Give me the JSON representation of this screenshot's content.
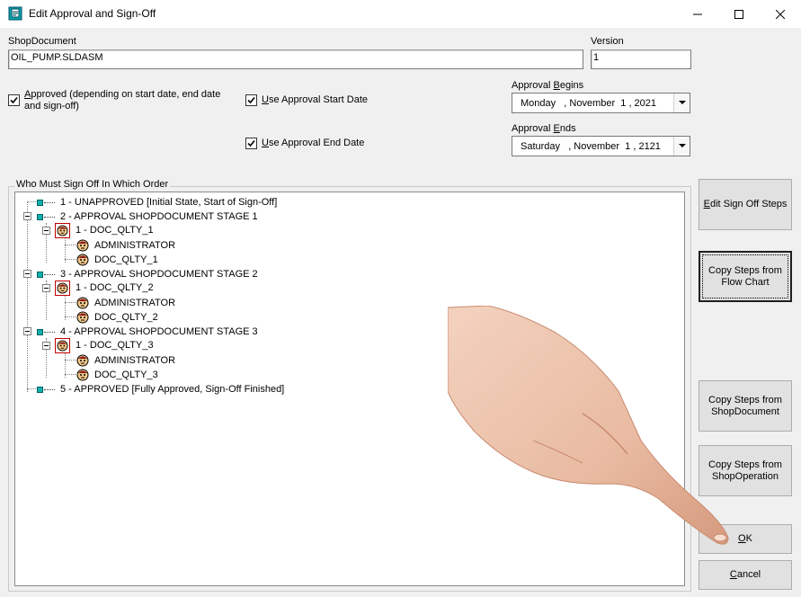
{
  "window": {
    "title": "Edit Approval and Sign-Off",
    "minimize_icon": "minimize-icon",
    "maximize_icon": "maximize-icon",
    "close_icon": "close-icon"
  },
  "form": {
    "shopdocument_label": "ShopDocument",
    "shopdocument_value": "OIL_PUMP.SLDASM",
    "version_label": "Version",
    "version_value": "1",
    "approved_label_u": "A",
    "approved_label_rest": "pproved (depending on start date, end date and sign-off)",
    "approved_checked": true,
    "use_start_u": "U",
    "use_start_rest": "se Approval Start Date",
    "use_start_checked": true,
    "use_end_u": "U",
    "use_end_rest": "se Approval End Date",
    "use_end_checked": true,
    "approval_begins_pre": "Approval ",
    "approval_begins_u": "B",
    "approval_begins_post": "egins",
    "approval_begins_value": "Monday   , November  1 , 2021",
    "approval_ends_pre": "Approval ",
    "approval_ends_u": "E",
    "approval_ends_post": "nds",
    "approval_ends_value": "Saturday   , November  1 , 2121"
  },
  "tree": {
    "group_title": "Who Must Sign Off In Which Order",
    "items": [
      {
        "label": "1 - UNAPPROVED [Initial State, Start of Sign-Off]"
      },
      {
        "label": "2 - APPROVAL SHOPDOCUMENT STAGE 1"
      },
      {
        "label": "1 - DOC_QLTY_1"
      },
      {
        "label": "ADMINISTRATOR"
      },
      {
        "label": "DOC_QLTY_1"
      },
      {
        "label": "3 - APPROVAL SHOPDOCUMENT STAGE 2"
      },
      {
        "label": "1 - DOC_QLTY_2"
      },
      {
        "label": "ADMINISTRATOR"
      },
      {
        "label": "DOC_QLTY_2"
      },
      {
        "label": "4 - APPROVAL SHOPDOCUMENT STAGE 3"
      },
      {
        "label": "1 - DOC_QLTY_3"
      },
      {
        "label": "ADMINISTRATOR"
      },
      {
        "label": "DOC_QLTY_3"
      },
      {
        "label": "5 - APPROVED [Fully Approved, Sign-Off Finished]"
      }
    ]
  },
  "buttons": {
    "edit_steps_u": "E",
    "edit_steps_rest": "dit Sign Off Steps",
    "copy_flow_line1": "Copy Steps from",
    "copy_flow_line2": "Flow Chart",
    "copy_shopdoc_line1": "Copy Steps from",
    "copy_shopdoc_line2": "ShopDocument",
    "copy_shopop_line1": "Copy Steps from",
    "copy_shopop_line2": "ShopOperation",
    "ok_u": "O",
    "ok_rest": "K",
    "cancel_u": "C",
    "cancel_rest": "ancel"
  },
  "colors": {
    "node_square": "#10b0b0",
    "face_box_border": "#c00000"
  }
}
